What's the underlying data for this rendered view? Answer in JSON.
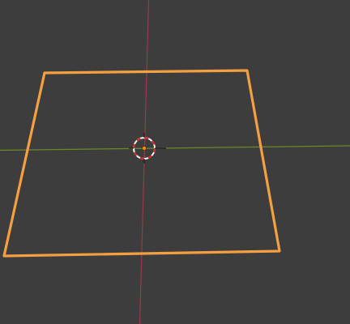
{
  "viewport": {
    "background_color": "#3d3d3d",
    "x_axis_color": "#9a3a45",
    "y_axis_color": "#6a8a2a",
    "selection_color": "#f5a040",
    "origin_color": "#f08a00",
    "cursor_colors": [
      "#e02020",
      "#ffffff"
    ],
    "selected_object": "plane-outline",
    "icons": [
      "3d-cursor-icon",
      "object-origin-icon"
    ]
  }
}
